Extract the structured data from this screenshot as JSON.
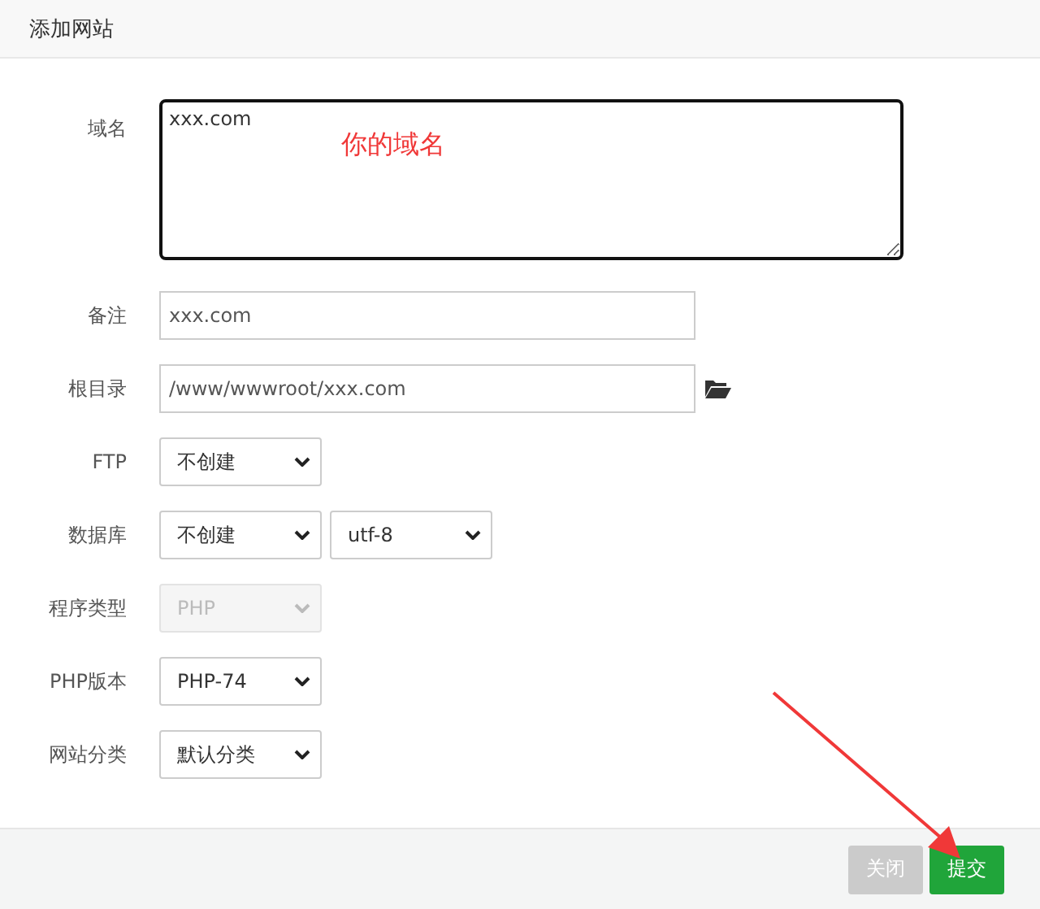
{
  "dialog": {
    "title": "添加网站"
  },
  "fields": [
    {
      "kind": "textarea",
      "label": "域名",
      "value": "xxx.com"
    },
    {
      "kind": "input",
      "label": "备注",
      "value": "xxx.com"
    },
    {
      "kind": "path",
      "label": "根目录",
      "value": "/www/wwwroot/xxx.com"
    },
    {
      "kind": "select",
      "label": "FTP",
      "options": [
        {
          "value": "不创建",
          "disabled": false
        }
      ]
    },
    {
      "kind": "select",
      "label": "数据库",
      "options": [
        {
          "value": "不创建",
          "disabled": false
        },
        {
          "value": "utf-8",
          "disabled": false
        }
      ]
    },
    {
      "kind": "select",
      "label": "程序类型",
      "options": [
        {
          "value": "PHP",
          "disabled": true
        }
      ]
    },
    {
      "kind": "select",
      "label": "PHP版本",
      "options": [
        {
          "value": "PHP-74",
          "disabled": false
        }
      ]
    },
    {
      "kind": "select",
      "label": "网站分类",
      "options": [
        {
          "value": "默认分类",
          "disabled": false
        }
      ]
    }
  ],
  "annotation": {
    "note": "你的域名"
  },
  "buttons": [
    {
      "kind": "cancel",
      "label": "关闭"
    },
    {
      "kind": "submit",
      "label": "提交"
    }
  ]
}
